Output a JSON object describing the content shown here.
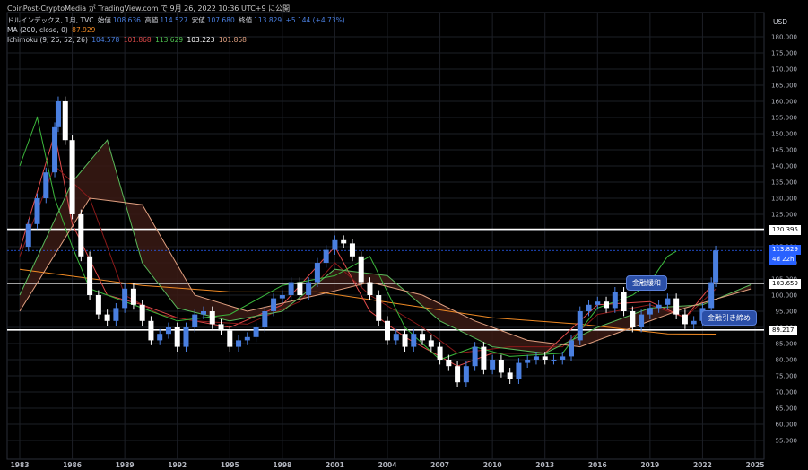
{
  "header": {
    "published": "CoinPost-CryptoMedia が TradingView.com で 9月 26, 2022 10:36 UTC+9 に公開"
  },
  "legend": {
    "symbol": "ドルインデックス, 1月, TVC",
    "open_label": "始値",
    "open": "108.636",
    "high_label": "高値",
    "high": "114.527",
    "low_label": "安値",
    "low": "107.680",
    "close_label": "終値",
    "close": "113.829",
    "change": "+5.144 (+4.73%)",
    "ma_label": "MA (200, close, 0)",
    "ma_value": "87.929",
    "ichimoku_label": "Ichimoku (9, 26, 52, 26)",
    "ichi_conversion": "104.578",
    "ichi_base": "101.868",
    "ichi_lagging": "113.629",
    "ichi_lead_a": "103.223",
    "ichi_lead_b": "101.868"
  },
  "axis": {
    "unit": "USD"
  },
  "price_tags": {
    "level_high": "120.395",
    "last_price": "113.829",
    "countdown": "4d 22h",
    "level_mid": "103.659",
    "level_low": "89.217"
  },
  "annotations": {
    "easing": "金融緩和",
    "tightening": "金融引き締め"
  },
  "colors": {
    "candle_up": "#4a7fe0",
    "candle_down": "#ffffff",
    "conversion": "#e04a4a",
    "base": "#8b1a1a",
    "lagging": "#3cb83c",
    "lead_a": "#5ab85a",
    "lead_b": "#e0a080",
    "cloud": "#3a1a14",
    "ma200": "#f08a24",
    "level_line": "#ffffff"
  },
  "chart_data": {
    "type": "line",
    "title": "ドルインデックス, 1月, TVC",
    "ylabel": "USD",
    "ylim": [
      50,
      185
    ],
    "xlim": [
      1982.5,
      2025.5
    ],
    "y_ticks": [
      55,
      60,
      65,
      70,
      75,
      80,
      85,
      90,
      95,
      100,
      105,
      110,
      115,
      120,
      125,
      130,
      135,
      140,
      145,
      150,
      155,
      160,
      165,
      170,
      175,
      180
    ],
    "x_ticks": [
      "1983",
      "1986",
      "1989",
      "1992",
      "1995",
      "1998",
      "2001",
      "2004",
      "2007",
      "2010",
      "2013",
      "2016",
      "2019",
      "2022",
      "2025"
    ],
    "horizontal_levels": [
      120.395,
      103.659,
      89.217
    ],
    "series": [
      {
        "type": "candles",
        "x": [
          1983,
          1983.5,
          1984,
          1984.5,
          1985,
          1985.2,
          1985.6,
          1986,
          1986.5,
          1987,
          1987.5,
          1988,
          1988.5,
          1989,
          1989.5,
          1990,
          1990.5,
          1991,
          1991.5,
          1992,
          1992.5,
          1993,
          1993.5,
          1994,
          1994.5,
          1995,
          1995.5,
          1996,
          1996.5,
          1997,
          1997.5,
          1998,
          1998.5,
          1999,
          1999.5,
          2000,
          2000.5,
          2001,
          2001.5,
          2002,
          2002.5,
          2003,
          2003.5,
          2004,
          2004.5,
          2005,
          2005.5,
          2006,
          2006.5,
          2007,
          2007.5,
          2008,
          2008.5,
          2009,
          2009.5,
          2010,
          2010.5,
          2011,
          2011.5,
          2012,
          2012.5,
          2013,
          2013.5,
          2014,
          2014.5,
          2015,
          2015.5,
          2016,
          2016.5,
          2017,
          2017.5,
          2018,
          2018.5,
          2019,
          2019.5,
          2020,
          2020.5,
          2021,
          2021.5,
          2022,
          2022.5,
          2022.75
        ],
        "values": [
          115,
          122,
          130,
          138,
          152,
          160,
          148,
          125,
          112,
          100,
          94,
          92,
          96,
          102,
          97,
          92,
          86,
          88,
          90,
          84,
          90,
          94,
          95,
          91,
          89,
          84,
          86,
          87,
          90,
          95,
          99,
          100,
          104,
          100,
          104,
          110,
          114,
          117,
          116,
          112,
          104,
          100,
          92,
          86,
          88,
          84,
          88,
          86,
          84,
          80,
          78,
          73,
          78,
          84,
          77,
          80,
          76,
          74,
          79,
          80,
          81,
          80,
          80,
          81,
          86,
          95,
          97,
          98,
          96,
          101,
          95,
          90,
          94,
          96,
          97,
          99,
          94,
          91,
          92,
          96,
          104,
          113.8
        ]
      },
      {
        "name": "MA (200, close, 0)",
        "x": [
          1983,
          1990,
          1995,
          2000,
          2005,
          2010,
          2015,
          2020,
          2022.75
        ],
        "values": [
          108,
          103,
          101,
          101,
          97,
          93,
          91,
          88,
          87.9
        ]
      },
      {
        "name": "Ichimoku conversion",
        "x": [
          1983,
          1985,
          1986,
          1988,
          1990,
          1992,
          1995,
          1998,
          2001,
          2003,
          2005,
          2008,
          2010,
          2013,
          2016,
          2019,
          2021,
          2022.75
        ],
        "values": [
          114,
          150,
          122,
          100,
          97,
          93,
          90,
          97,
          115,
          95,
          87,
          78,
          82,
          82,
          97,
          98,
          93,
          104.6
        ]
      },
      {
        "name": "Ichimoku base",
        "x": [
          1983,
          1985,
          1987,
          1989,
          1991,
          1993,
          1996,
          1999,
          2001,
          2003,
          2006,
          2008,
          2011,
          2014,
          2016,
          2019,
          2021,
          2022.75
        ],
        "values": [
          112,
          140,
          130,
          100,
          94,
          92,
          91,
          98,
          110,
          100,
          90,
          82,
          84,
          84,
          94,
          97,
          93,
          101.9
        ]
      },
      {
        "name": "Ichimoku lagging",
        "x": [
          1983,
          1984,
          1985,
          1986,
          1987,
          1988,
          1990,
          1992,
          1995,
          1998,
          2001,
          2003,
          2005,
          2007,
          2009,
          2011,
          2014,
          2016,
          2018,
          2019,
          2020,
          2020.5
        ],
        "values": [
          140,
          155,
          130,
          115,
          102,
          100,
          96,
          92,
          94,
          103,
          106,
          112,
          90,
          80,
          84,
          81,
          82,
          96,
          100,
          104,
          112,
          113.6
        ]
      },
      {
        "name": "Ichimoku lead A",
        "x": [
          1983,
          1986,
          1988,
          1990,
          1992,
          1995,
          1998,
          2001,
          2004,
          2007,
          2010,
          2013,
          2016,
          2019,
          2022,
          2024.75
        ],
        "values": [
          100,
          135,
          148,
          110,
          96,
          92,
          95,
          108,
          106,
          92,
          84,
          82,
          90,
          96,
          97,
          103.2
        ]
      },
      {
        "name": "Ichimoku lead B",
        "x": [
          1983,
          1987,
          1990,
          1993,
          1996,
          2000,
          2003,
          2006,
          2009,
          2012,
          2015,
          2018,
          2021,
          2024.75
        ],
        "values": [
          95,
          130,
          128,
          100,
          95,
          100,
          104,
          100,
          92,
          86,
          84,
          90,
          96,
          101.9
        ]
      }
    ]
  }
}
